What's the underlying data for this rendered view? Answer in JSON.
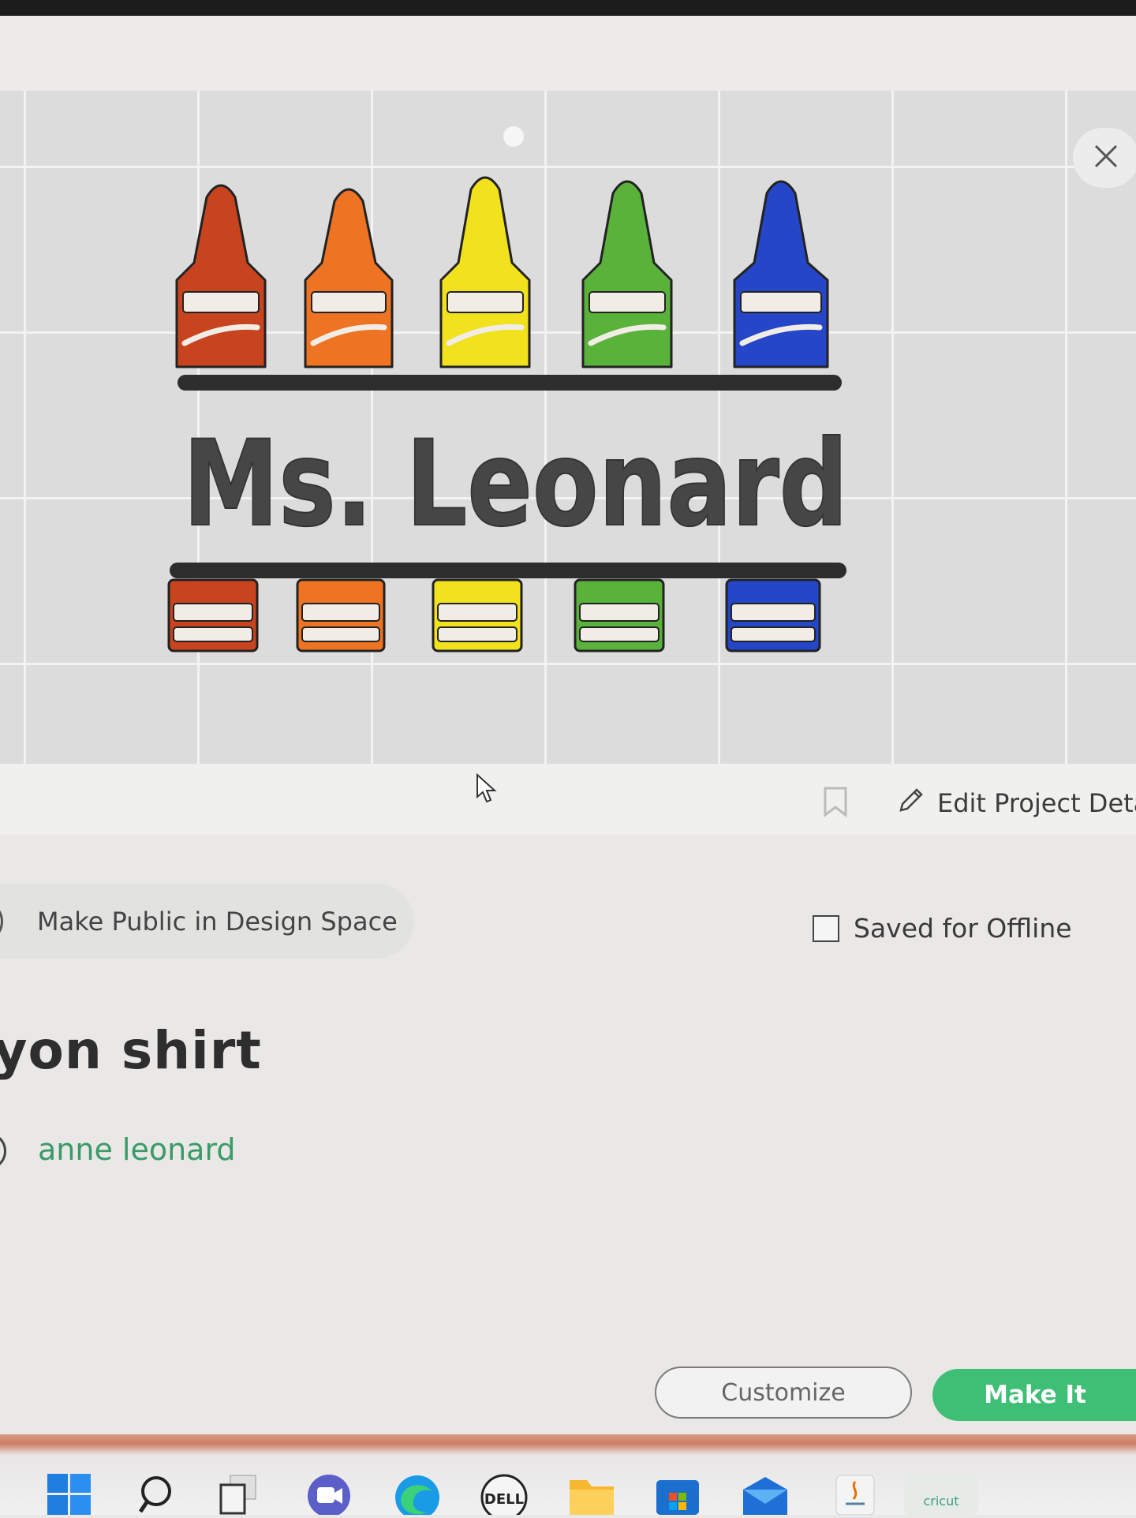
{
  "design": {
    "name_text": "Ms. Leonard",
    "crayon_colors": [
      "#c8441f",
      "#ee7322",
      "#f2e11d",
      "#59b23a",
      "#2446c7"
    ]
  },
  "icons": {
    "close": "close-icon",
    "bookmark": "bookmark-icon",
    "edit": "pencil-icon",
    "cursor": "mouse-pointer-icon"
  },
  "actions": {
    "edit_details": "Edit Project Deta",
    "make_public": "Make Public in Design Space",
    "saved_offline": "Saved for Offline"
  },
  "project": {
    "title": "ayon shirt",
    "author": "anne leonard"
  },
  "buttons": {
    "customize": "Customize",
    "make_it": "Make It"
  },
  "taskbar": {
    "items": [
      "start-icon",
      "search-icon",
      "task-view-icon",
      "meet-icon",
      "edge-icon",
      "dell-icon",
      "file-explorer-icon",
      "store-icon",
      "mail-icon",
      "java-icon",
      "cricut-icon"
    ],
    "dell_label": "DELL",
    "cricut_label": "cricut"
  },
  "colors": {
    "accent_green": "#3fbf76",
    "author_green": "#3a9a68"
  }
}
